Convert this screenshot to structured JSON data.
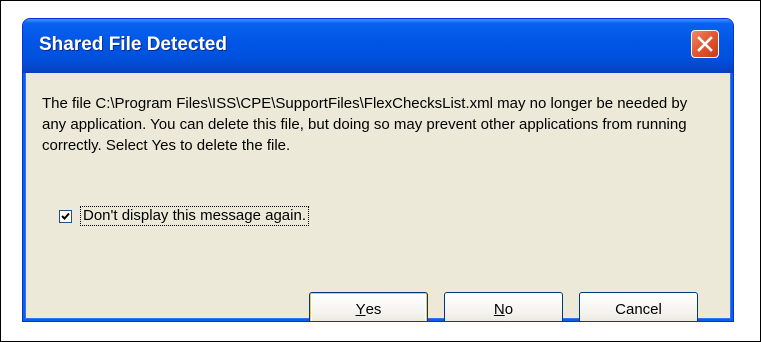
{
  "dialog": {
    "title": "Shared File Detected",
    "message": "The file C:\\Program Files\\ISS\\CPE\\SupportFiles\\FlexChecksList.xml may no longer be needed by any application. You can delete this file, but doing so may prevent other applications from running correctly.  Select Yes to delete the file.",
    "checkbox": {
      "label": "Don't display this message again.",
      "checked": true
    },
    "buttons": {
      "yes": {
        "mnemonic": "Y",
        "rest": "es"
      },
      "no": {
        "mnemonic": "N",
        "rest": "o"
      },
      "cancel": {
        "label": "Cancel"
      }
    }
  },
  "colors": {
    "titlebar": "#0055e5",
    "client": "#ece9d8",
    "close": "#e25a32",
    "default_button_border": "#f7c54d"
  }
}
